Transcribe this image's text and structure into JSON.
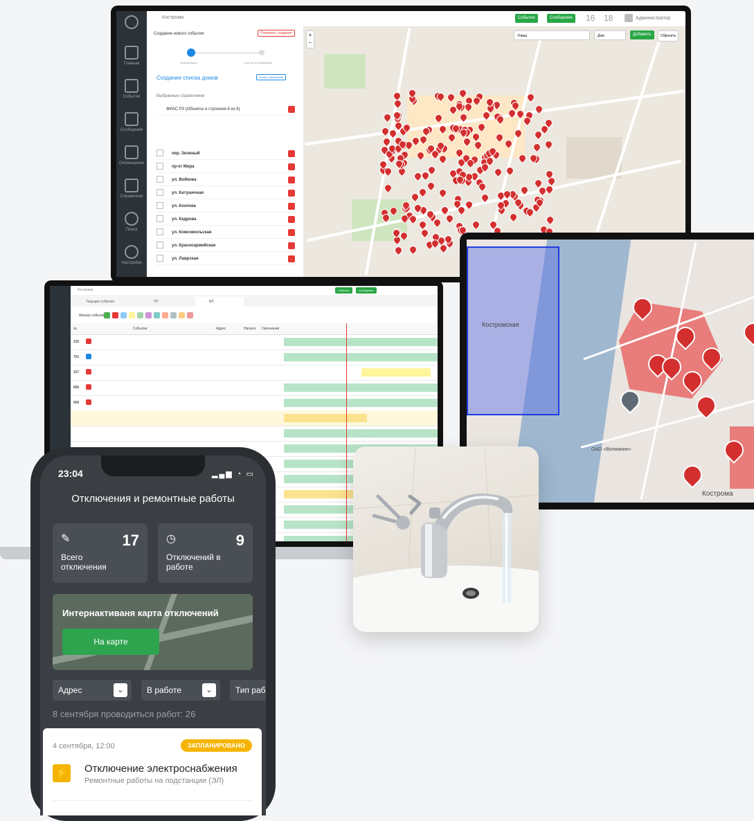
{
  "desktop": {
    "breadcrumb": "Кострома",
    "top_buttons": [
      "Событие",
      "Сообщение"
    ],
    "counters": [
      "16",
      "18"
    ],
    "user": "Администратор",
    "panel_title": "Создание нового события",
    "panel_cancel": "Отменить создание",
    "steps": [
      "Информация",
      "Список пострадавших"
    ],
    "subtitle": "Создание списка домов",
    "subtitle_button": "Искать справочник",
    "dict_label": "Выбранные справочники",
    "dict_item": "ФИАС Р3 (Объекты и строения 6 из 6)",
    "streets": [
      "пер. Зеленый",
      "пр-кт Мира",
      "ул. Войкова",
      "ул. Катушечная",
      "ул. Козлова",
      "ул. Кедрова",
      "ул. Комсомольская",
      "ул. Красноармейская",
      "ул. Лаврская"
    ],
    "map_filters": [
      "Улица",
      "Дом"
    ],
    "map_add": "Добавить",
    "map_clear": "Сбросить"
  },
  "laptop": {
    "breadcrumb": "Кострома",
    "tabs": [
      "Текущие события",
      "ТП",
      "ВЛ"
    ],
    "filter_label": "Фильтр событий:",
    "columns": [
      "№",
      "Событие",
      "Адрес",
      "Начало",
      "Окончание"
    ],
    "row_ids": [
      "335",
      "761",
      "327",
      "806",
      "900"
    ]
  },
  "tablet": {
    "labels": [
      "Костромская",
      "ОАО «Волжанин»",
      "Кострома"
    ]
  },
  "phone": {
    "time": "23:04",
    "title": "Отключения и ремонтные работы",
    "stat_total_label": "Всего отключения",
    "stat_total_value": "17",
    "stat_work_label": "Отключений в работе",
    "stat_work_value": "9",
    "map_card_title": "Интернактиваня карта отключений",
    "map_button": "На карте",
    "filters": [
      "Адрес",
      "В работе",
      "Тип работ"
    ],
    "summary": "8 сентября проводиться работ: 26",
    "event": {
      "date": "4 сентября, 12:00",
      "badge": "ЗАПЛАНИРОВАНО",
      "title": "Отключение электроснабжения",
      "subtitle": "Ремонтные работы на подстанции (ЭЛ)"
    }
  },
  "colors": {
    "green": "#28a745",
    "pin_red": "#d32f2f",
    "badge_yellow": "#f5b400",
    "phone_bg": "#3b3f44"
  }
}
